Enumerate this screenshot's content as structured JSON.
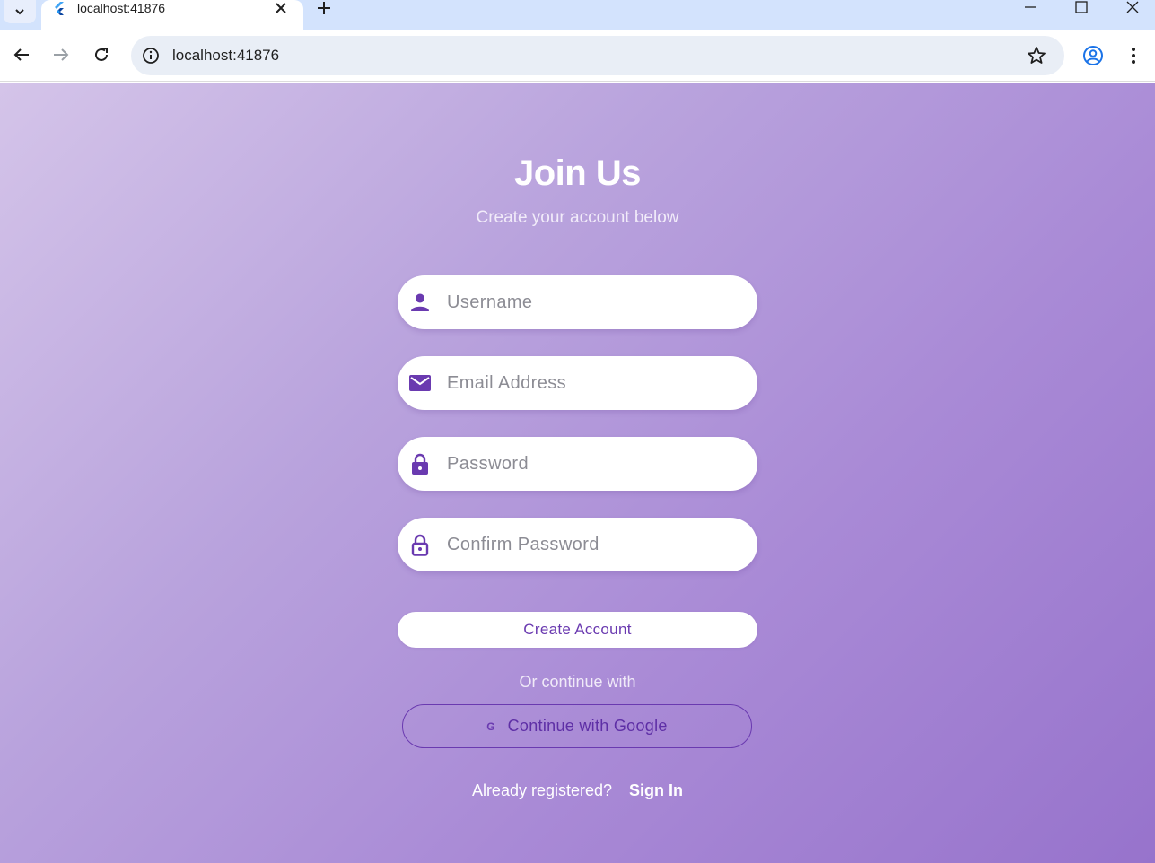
{
  "browser": {
    "tab_title": "localhost:41876",
    "url": "localhost:41876",
    "icons": {
      "tab_menu": "chevron-down-icon",
      "favicon": "flutter-icon",
      "tab_close": "close-icon",
      "new_tab": "plus-icon",
      "back": "back-arrow-icon",
      "forward": "forward-arrow-icon",
      "reload": "reload-icon",
      "site_info": "info-icon",
      "bookmark": "star-icon",
      "profile": "profile-icon",
      "menu": "kebab-menu-icon",
      "minimize": "minimize-icon",
      "maximize": "maximize-icon",
      "close_window": "close-icon"
    }
  },
  "signup": {
    "title": "Join Us",
    "subtitle": "Create your account below",
    "fields": [
      {
        "placeholder": "Username",
        "value": "",
        "icon": "person-icon"
      },
      {
        "placeholder": "Email Address",
        "value": "",
        "icon": "mail-icon"
      },
      {
        "placeholder": "Password",
        "value": "",
        "icon": "lock-filled-icon"
      },
      {
        "placeholder": "Confirm Password",
        "value": "",
        "icon": "lock-outline-icon"
      }
    ],
    "create_button": "Create Account",
    "divider_text": "Or continue with",
    "google_icon_text": "G",
    "google_button": "Continue with Google",
    "signin_prompt": "Already registered?",
    "signin_link": "Sign In"
  },
  "colors": {
    "accent": "#6a3ab0",
    "gradient_start": "#d4c4e9",
    "gradient_end": "#9773cc",
    "browser_tabstrip": "#d3e3fd",
    "omnibox": "#e9eef6"
  }
}
